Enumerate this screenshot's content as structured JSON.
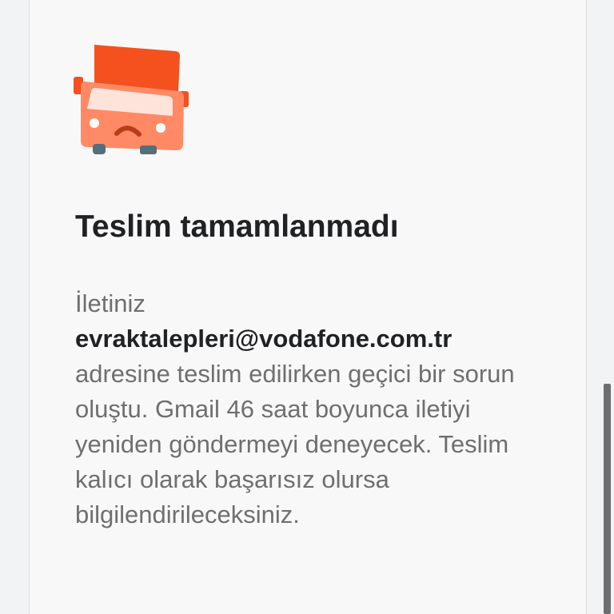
{
  "notice": {
    "icon": "delivery-truck-icon",
    "title": "Teslim tamamlanmadı",
    "message_intro": "İletiniz",
    "recipient_email": "evraktalepleri@vodafone.com.tr",
    "message_body": "adresine teslim edilirken geçici bir sorun oluştu. Gmail 46 saat boyunca iletiyi yeniden göndermeyi deneyecek. Teslim kalıcı olarak başarısız olursa bilgilendirileceksiniz."
  },
  "colors": {
    "truck_primary": "#f4511e",
    "truck_face": "#ff8a65",
    "title_text": "#202124",
    "body_text": "#6f6f6f"
  }
}
